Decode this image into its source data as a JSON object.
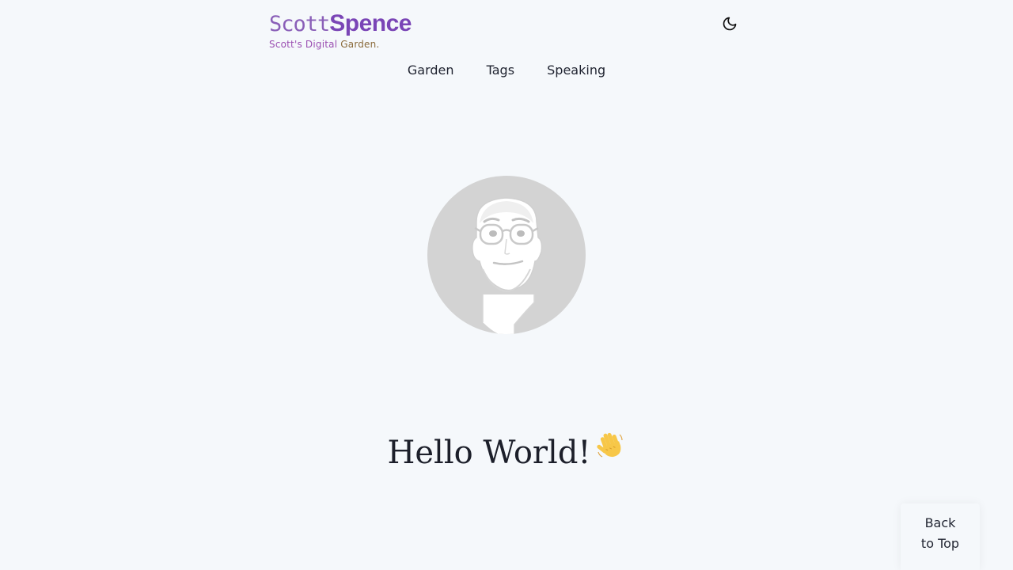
{
  "header": {
    "logo_first": "Scott",
    "logo_last": "Spence",
    "tagline_part1": "Scott's Digital",
    "tagline_part2": "Garden",
    "tagline_end": ".",
    "theme_toggle_icon": "moon-icon"
  },
  "nav": {
    "items": [
      {
        "label": "Garden"
      },
      {
        "label": "Tags"
      },
      {
        "label": "Speaking"
      }
    ]
  },
  "hero": {
    "avatar_icon": "avatar-illustration",
    "heading": "Hello World!",
    "emoji_icon": "waving-hand-icon"
  },
  "back_to_top": {
    "line1": "Back",
    "line2": "to Top"
  },
  "colors": {
    "background": "#f5f8fb",
    "brand_purple": "#7a45b6",
    "avatar_bg": "#d3d3d3"
  }
}
